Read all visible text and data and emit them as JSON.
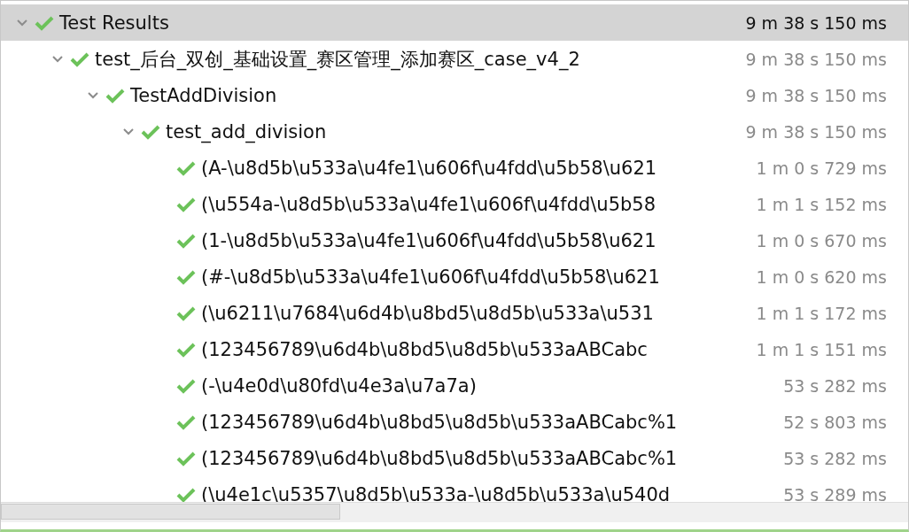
{
  "results": [
    {
      "label": "Test Results",
      "duration": "9 m 38 s 150 ms",
      "selected": true,
      "expanded": true,
      "children": [
        {
          "label": "test_后台_双创_基础设置_赛区管理_添加赛区_case_v4_2",
          "duration": "9 m 38 s 150 ms",
          "selected": false,
          "expanded": true,
          "children": [
            {
              "label": "TestAddDivision",
              "duration": "9 m 38 s 150 ms",
              "selected": false,
              "expanded": true,
              "children": [
                {
                  "label": "test_add_division",
                  "duration": "9 m 38 s 150 ms",
                  "selected": false,
                  "expanded": true,
                  "children": [
                    {
                      "label": "(A-\\u8d5b\\u533a\\u4fe1\\u606f\\u4fdd\\u5b58\\u621",
                      "duration": "1 m 0 s 729 ms",
                      "selected": false
                    },
                    {
                      "label": "(\\u554a-\\u8d5b\\u533a\\u4fe1\\u606f\\u4fdd\\u5b58",
                      "duration": "1 m 1 s 152 ms",
                      "selected": false
                    },
                    {
                      "label": "(1-\\u8d5b\\u533a\\u4fe1\\u606f\\u4fdd\\u5b58\\u621",
                      "duration": "1 m 0 s 670 ms",
                      "selected": false
                    },
                    {
                      "label": "(#-\\u8d5b\\u533a\\u4fe1\\u606f\\u4fdd\\u5b58\\u621",
                      "duration": "1 m 0 s 620 ms",
                      "selected": false
                    },
                    {
                      "label": "(\\u6211\\u7684\\u6d4b\\u8bd5\\u8d5b\\u533a\\u531",
                      "duration": "1 m 1 s 172 ms",
                      "selected": false
                    },
                    {
                      "label": "(123456789\\u6d4b\\u8bd5\\u8d5b\\u533aABCabc",
                      "duration": "1 m 1 s 151 ms",
                      "selected": false
                    },
                    {
                      "label": "(-\\u4e0d\\u80fd\\u4e3a\\u7a7a)",
                      "duration": "53 s 282 ms",
                      "selected": false
                    },
                    {
                      "label": "(123456789\\u6d4b\\u8bd5\\u8d5b\\u533aABCabc%1",
                      "duration": "52 s 803 ms",
                      "selected": false
                    },
                    {
                      "label": "(123456789\\u6d4b\\u8bd5\\u8d5b\\u533aABCabc%1",
                      "duration": "53 s 282 ms",
                      "selected": false
                    },
                    {
                      "label": "(\\u4e1c\\u5357\\u8d5b\\u533a-\\u8d5b\\u533a\\u540d",
                      "duration": "53 s 289 ms",
                      "selected": false
                    }
                  ]
                }
              ]
            }
          ]
        }
      ]
    }
  ]
}
